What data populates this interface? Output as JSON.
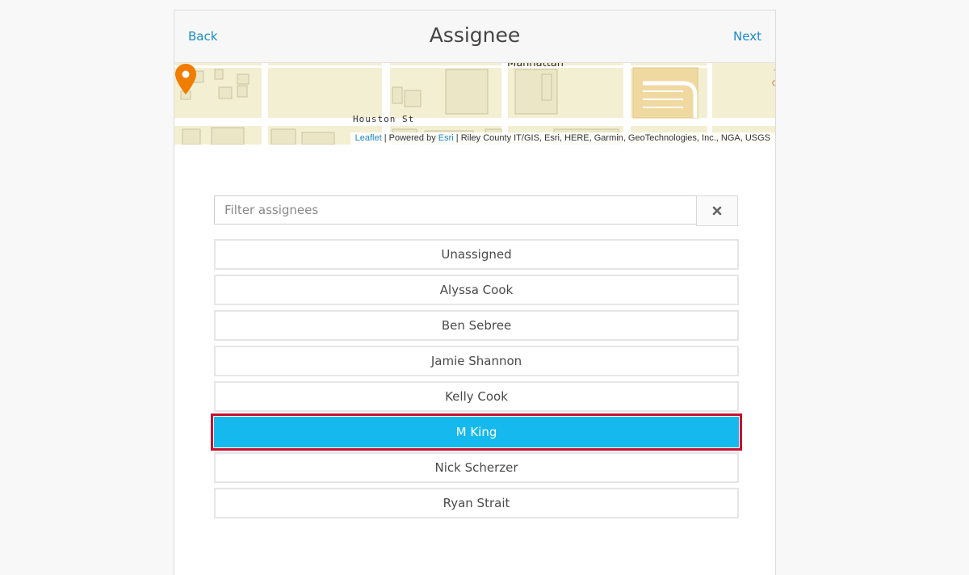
{
  "header": {
    "back_label": "Back",
    "title": "Assignee",
    "next_label": "Next"
  },
  "map": {
    "street_label": "Houston St",
    "area_label": "Manhattan",
    "attribution": {
      "leaflet": "Leaflet",
      "powered_by": " | Powered by ",
      "esri": "Esri",
      "sources": " | Riley County IT/GIS, Esri, HERE, Garmin, GeoTechnologies, Inc., NGA, USGS"
    },
    "pin_color": "#f07c00"
  },
  "filter": {
    "placeholder": "Filter assignees",
    "value": ""
  },
  "assignees": [
    {
      "label": "Unassigned",
      "selected": false
    },
    {
      "label": "Alyssa Cook",
      "selected": false
    },
    {
      "label": "Ben Sebree",
      "selected": false
    },
    {
      "label": "Jamie Shannon",
      "selected": false
    },
    {
      "label": "Kelly Cook",
      "selected": false
    },
    {
      "label": "M King",
      "selected": true
    },
    {
      "label": "Nick Scherzer",
      "selected": false
    },
    {
      "label": "Ryan Strait",
      "selected": false
    }
  ],
  "colors": {
    "accent": "#1a8bc8",
    "selected_bg": "#16b9ee",
    "highlight_outline": "#c8102e"
  }
}
